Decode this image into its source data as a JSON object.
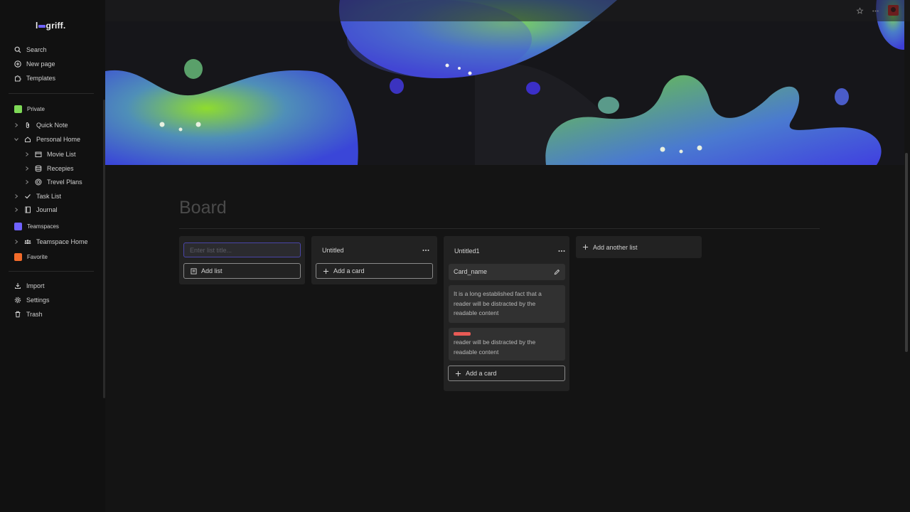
{
  "app": {
    "logo_prefix": "l",
    "logo_text": "griff.",
    "accent": "#6f62ff"
  },
  "sidebar": {
    "top": [
      {
        "label": "Search",
        "icon": "search-icon"
      },
      {
        "label": "New page",
        "icon": "plus-circle-icon"
      },
      {
        "label": "Templates",
        "icon": "puzzle-icon"
      }
    ],
    "private_label": "Private",
    "private_color": "#7ed957",
    "private_items": [
      {
        "label": "Quick Note",
        "icon": "paperclip-icon"
      },
      {
        "label": "Personal Home",
        "icon": "home-icon"
      },
      {
        "label": "Movie List",
        "icon": "calendar-icon"
      },
      {
        "label": "Recepies",
        "icon": "database-icon"
      },
      {
        "label": "Trevel Plans",
        "icon": "target-icon"
      },
      {
        "label": "Task List",
        "icon": "check-icon"
      },
      {
        "label": "Journal",
        "icon": "book-icon"
      }
    ],
    "teamspaces_label": "Teamspaces",
    "teamspaces_color": "#6f62ff",
    "teamspace_items": [
      {
        "label": "Teamspace Home",
        "icon": "team-icon"
      }
    ],
    "favorite_label": "Favorite",
    "favorite_color": "#f26b2a",
    "bottom": [
      {
        "label": "Import",
        "icon": "import-icon"
      },
      {
        "label": "Settings",
        "icon": "gear-icon"
      },
      {
        "label": "Trash",
        "icon": "trash-icon"
      }
    ]
  },
  "page": {
    "title": "Board"
  },
  "board": {
    "new_list": {
      "placeholder": "Enter list title...",
      "add_label": "Add list"
    },
    "lists": [
      {
        "title": "Untitled",
        "add_card_label": "Add a card"
      },
      {
        "title": "Untitled1",
        "cards": [
          {
            "name": "Card_name"
          },
          {
            "text": "It is a long established fact that a reader will be distracted by the readable content"
          },
          {
            "label_color": "#e85a55",
            "text": "reader will be distracted by the readable content"
          }
        ],
        "add_card_label": "Add a card"
      }
    ],
    "add_another_label": "Add another list"
  }
}
